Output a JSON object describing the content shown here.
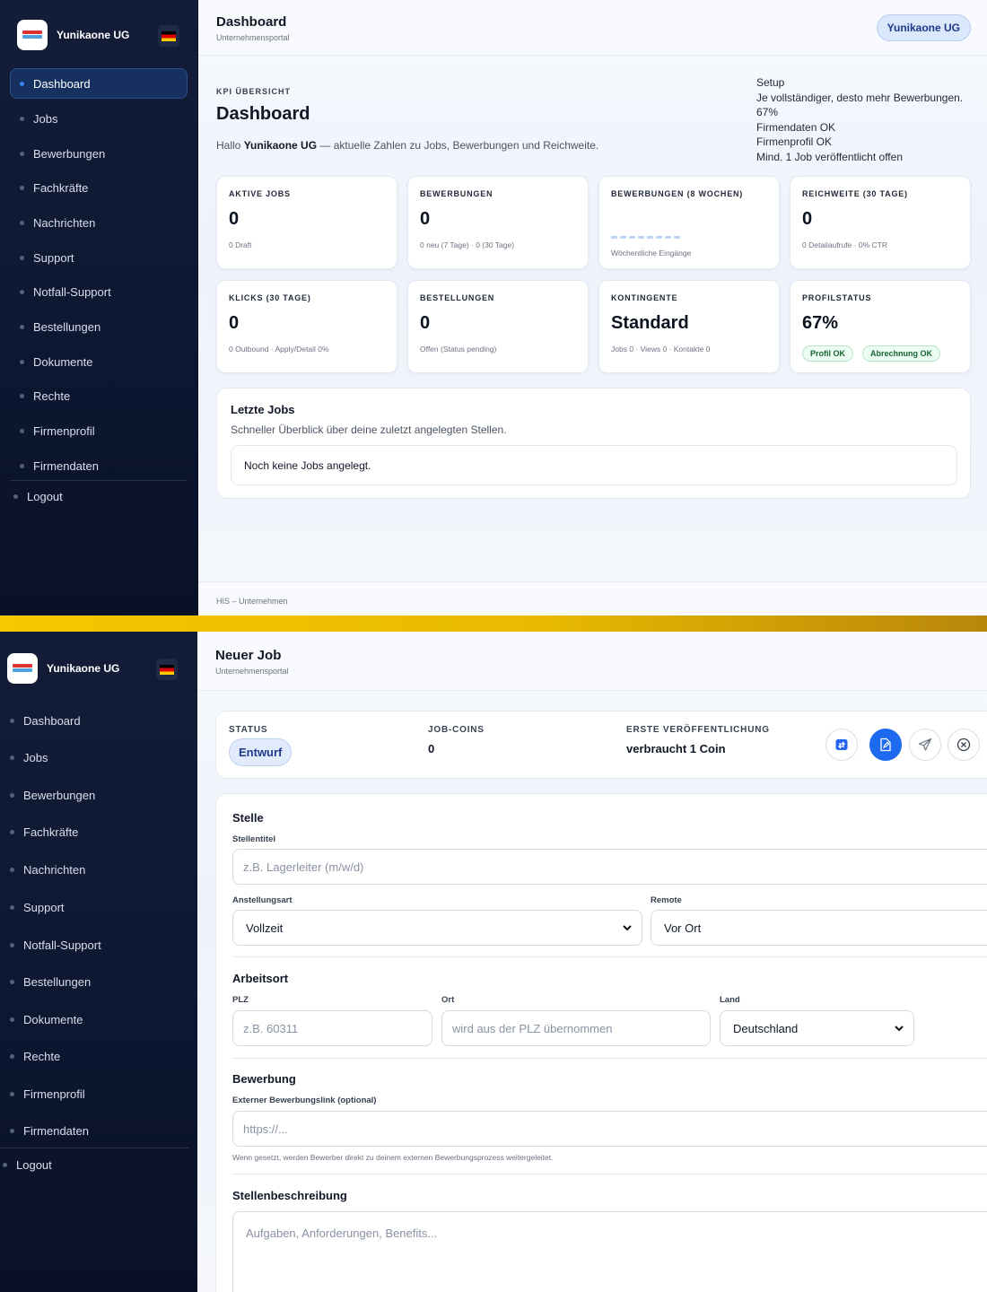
{
  "brand": {
    "name": "Yunikaone UG"
  },
  "nav": {
    "items": [
      "Dashboard",
      "Jobs",
      "Bewerbungen",
      "Fachkräfte",
      "Nachrichten",
      "Support",
      "Notfall-Support",
      "Bestellungen",
      "Dokumente",
      "Rechte",
      "Firmenprofil",
      "Firmendaten"
    ],
    "logout": "Logout"
  },
  "dashboard": {
    "topbar": {
      "title": "Dashboard",
      "subtitle": "Unternehmensportal",
      "user": "Yunikaone UG"
    },
    "eyebrow": "KPI ÜBERSICHT",
    "title": "Dashboard",
    "hello_prefix": "Hallo ",
    "hello_name": "Yunikaone UG",
    "hello_suffix": " — aktuelle Zahlen zu Jobs, Bewerbungen und Reichweite.",
    "setup": [
      "Setup",
      "Je vollständiger, desto mehr Bewerbungen.",
      "67%",
      "Firmendaten OK",
      "Firmenprofil OK",
      "Mind. 1 Job veröffentlicht offen"
    ],
    "cards": [
      {
        "label": "AKTIVE JOBS",
        "value": "0",
        "sub": "0 Draft"
      },
      {
        "label": "BEWERBUNGEN",
        "value": "0",
        "sub": "0 neu (7 Tage) · 0 (30 Tage)"
      },
      {
        "label": "BEWERBUNGEN (8 WOCHEN)",
        "sub": "Wöchentliche Eingänge",
        "weekly": [
          0,
          0,
          0,
          0,
          0,
          0,
          0,
          0
        ]
      },
      {
        "label": "REICHWEITE (30 TAGE)",
        "value": "0",
        "sub": "0 Detailaufrufe · 0% CTR"
      },
      {
        "label": "KLICKS (30 TAGE)",
        "value": "0",
        "sub": "0 Outbound · Apply/Detail 0%"
      },
      {
        "label": "BESTELLUNGEN",
        "value": "0",
        "sub": "Offen (Status pending)"
      },
      {
        "label": "KONTINGENTE",
        "value": "Standard",
        "sub": "Jobs 0 · Views 0 · Kontakte 0"
      },
      {
        "label": "PROFILSTATUS",
        "value": "67%",
        "badges": [
          "Profil OK",
          "Abrechnung OK"
        ]
      }
    ],
    "recent_jobs": {
      "title": "Letzte Jobs",
      "subtitle": "Schneller Überblick über deine zuletzt angelegten Stellen.",
      "empty": "Noch keine Jobs angelegt."
    },
    "footer": "HIS – Unternehmen"
  },
  "new_job": {
    "topbar": {
      "title": "Neuer Job",
      "subtitle": "Unternehmensportal"
    },
    "status": {
      "label": "STATUS",
      "value": "Entwurf"
    },
    "coins": {
      "label": "JOB-COINS",
      "value": "0"
    },
    "first_publish": {
      "label": "ERSTE VERÖFFENTLICHUNG",
      "value": "verbraucht 1 Coin"
    },
    "sections": {
      "stelle": "Stelle",
      "arbeitsort": "Arbeitsort",
      "bewerbung": "Bewerbung",
      "beschreibung": "Stellenbeschreibung"
    },
    "fields": {
      "stellentitel": {
        "label": "Stellentitel",
        "placeholder": "z.B. Lagerleiter (m/w/d)"
      },
      "anstellungsart": {
        "label": "Anstellungsart",
        "value": "Vollzeit"
      },
      "remote": {
        "label": "Remote",
        "value": "Vor Ort"
      },
      "plz": {
        "label": "PLZ",
        "placeholder": "z.B. 60311"
      },
      "ort": {
        "label": "Ort",
        "placeholder": "wird aus der PLZ übernommen"
      },
      "land": {
        "label": "Land",
        "value": "Deutschland"
      },
      "link": {
        "label": "Externer Bewerbungslink (optional)",
        "placeholder": "https://...",
        "hint": "Wenn gesetzt, werden Bewerber direkt zu deinem externen Bewerbungsprozess weitergeleitet."
      },
      "beschreibung": {
        "placeholder": "Aufgaben, Anforderungen, Benefits..."
      }
    }
  }
}
